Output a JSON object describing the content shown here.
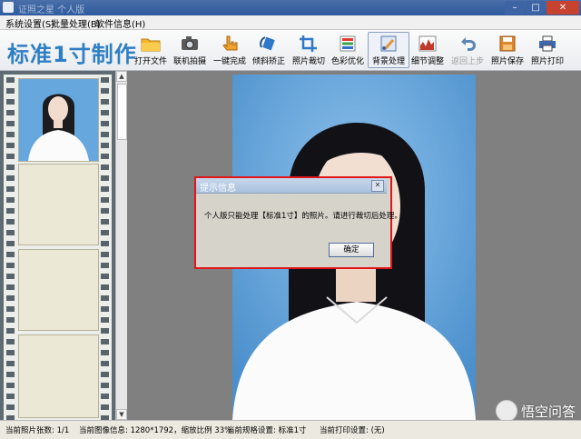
{
  "window": {
    "title": "证照之星 个人版",
    "controls": [
      "minimize",
      "maximize",
      "close"
    ]
  },
  "menu": [
    "系统设置(S)",
    "批量处理(B)",
    "软件信息(H)"
  ],
  "app_heading": "标准1寸制作",
  "toolbar": [
    {
      "label": "打开文件",
      "icon": "folder-icon"
    },
    {
      "label": "联机拍摄",
      "icon": "camera-icon"
    },
    {
      "label": "一键完成",
      "icon": "hand-pointer-icon"
    },
    {
      "label": "倾斜矫正",
      "icon": "rotate-icon"
    },
    {
      "label": "照片裁切",
      "icon": "crop-icon"
    },
    {
      "label": "色彩优化",
      "icon": "color-bars-icon"
    },
    {
      "label": "背景处理",
      "icon": "background-brush-icon",
      "active": true
    },
    {
      "label": "细节调整",
      "icon": "histogram-icon"
    },
    {
      "label": "返回上步",
      "icon": "undo-icon",
      "disabled": true
    },
    {
      "label": "照片保存",
      "icon": "save-icon"
    },
    {
      "label": "照片打印",
      "icon": "printer-icon"
    }
  ],
  "dialog": {
    "title": "提示信息",
    "message": "个人版只能处理【标准1寸】的照片。请进行裁切后处理。",
    "ok_label": "确定"
  },
  "status": {
    "photo_count": "当前照片张数: 1/1",
    "image_info": "当前图像信息: 1280*1792，缩放比例 33%",
    "spec": "当前规格设置: 标准1寸",
    "print": "当前打印设置: (无)"
  },
  "watermark": "悟空问答",
  "colors": {
    "accent": "#2f7fc4",
    "photo_bg": "#5b9fd6",
    "dialog_border": "#e0161b"
  }
}
